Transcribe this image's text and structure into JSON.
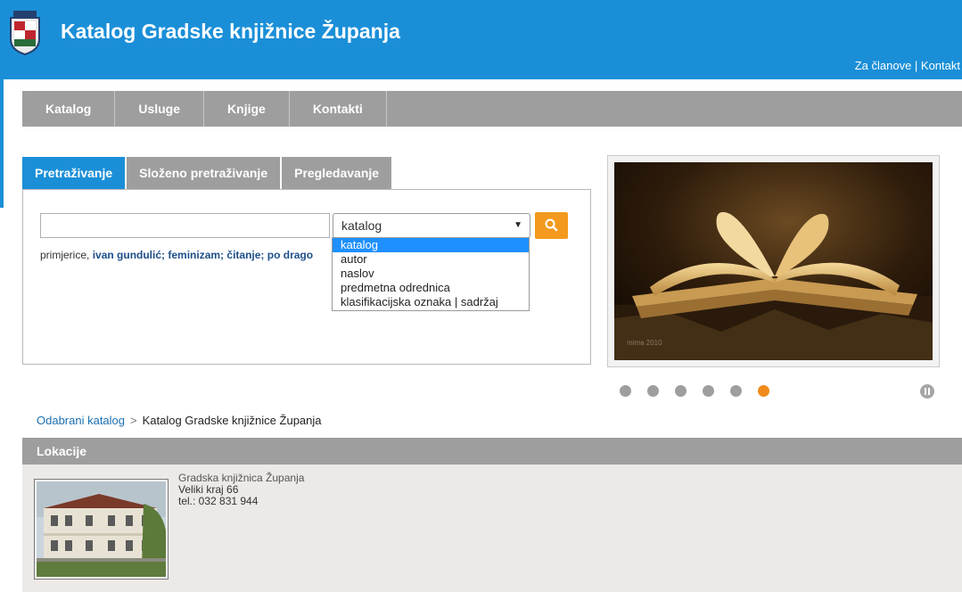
{
  "header": {
    "title": "Katalog Gradske knjižnice Županja",
    "links": {
      "members": "Za članove",
      "separator": " | ",
      "contact": "Kontakt"
    }
  },
  "nav": {
    "items": [
      {
        "label": "Katalog"
      },
      {
        "label": "Usluge"
      },
      {
        "label": "Knjige"
      },
      {
        "label": "Kontakti"
      }
    ]
  },
  "search": {
    "tabs": [
      {
        "label": "Pretraživanje",
        "active": true
      },
      {
        "label": "Složeno pretraživanje",
        "active": false
      },
      {
        "label": "Pregledavanje",
        "active": false
      }
    ],
    "input_value": "",
    "select_value": "katalog",
    "options": [
      "katalog",
      "autor",
      "naslov",
      "predmetna odrednica",
      "klasifikacijska oznaka | sadržaj"
    ],
    "examples_prefix": "primjerice,",
    "examples": [
      "ivan gundulić;",
      "feminizam;",
      "čitanje;",
      "po drago"
    ]
  },
  "slideshow": {
    "dots": 6,
    "active_dot": 6,
    "caption": "mima 2010"
  },
  "breadcrumb": {
    "parent": "Odabrani katalog",
    "separator": ">",
    "current": "Katalog Gradske knjižnice Županja"
  },
  "locations": {
    "title": "Lokacije",
    "library": {
      "name": "Gradska knjižnica Županja",
      "address": "Veliki kraj 66",
      "phone": "tel.: 032 831 944"
    }
  },
  "colors": {
    "brand_blue": "#1a8fd8",
    "nav_gray": "#9e9e9e",
    "accent_orange": "#f39a1e"
  }
}
